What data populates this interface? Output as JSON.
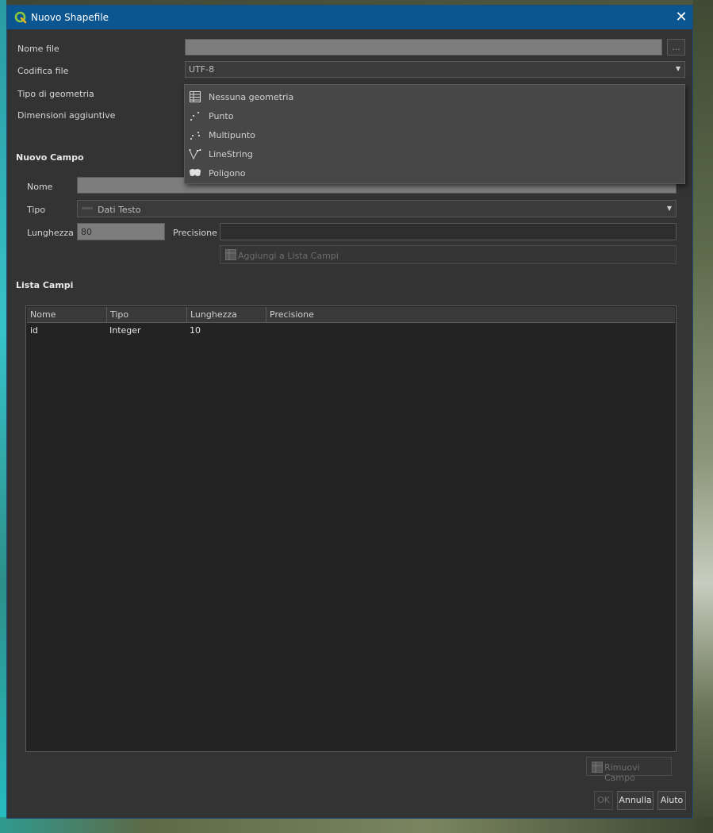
{
  "window": {
    "title": "Nuovo Shapefile",
    "close_glyph": "✕"
  },
  "form": {
    "nome_file_label": "Nome file",
    "nome_file_value": "",
    "browse_label": "...",
    "codifica_label": "Codifica file",
    "codifica_value": "UTF-8",
    "tipo_geometria_label": "Tipo di geometria",
    "dimensioni_label": "Dimensioni aggiuntive"
  },
  "geometry_menu": {
    "items": [
      {
        "label": "Nessuna geometria",
        "icon": "table-icon"
      },
      {
        "label": "Punto",
        "icon": "point-icon"
      },
      {
        "label": "Multipunto",
        "icon": "multipoint-icon"
      },
      {
        "label": "LineString",
        "icon": "linestring-icon"
      },
      {
        "label": "Poligono",
        "icon": "polygon-icon"
      }
    ]
  },
  "nuovo_campo": {
    "title": "Nuovo Campo",
    "nome_label": "Nome",
    "nome_value": "",
    "tipo_label": "Tipo",
    "tipo_value": "Dati Testo",
    "lunghezza_label": "Lunghezza",
    "lunghezza_value": "80",
    "precisione_label": "Precisione",
    "precisione_value": "",
    "add_button": "Aggiungi a Lista Campi"
  },
  "lista_campi": {
    "title": "Lista Campi",
    "columns": [
      "Nome",
      "Tipo",
      "Lunghezza",
      "Precisione"
    ],
    "rows": [
      {
        "nome": "id",
        "tipo": "Integer",
        "lunghezza": "10",
        "precisione": ""
      }
    ],
    "remove_button": "Rimuovi Campo"
  },
  "footer": {
    "ok": "OK",
    "cancel": "Annulla",
    "help": "Aiuto"
  },
  "colors": {
    "titlebar": "#0b5590",
    "dialog_bg": "#333333",
    "accent_green": "#8dc63f"
  }
}
